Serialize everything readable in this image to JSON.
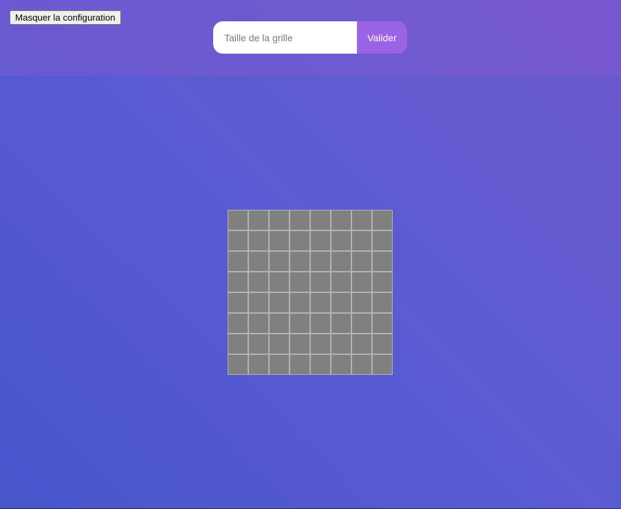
{
  "config": {
    "toggle_label": "Masquer la configuration",
    "grid_size_placeholder": "Taille de la grille",
    "grid_size_value": "",
    "submit_label": "Valider"
  },
  "grid": {
    "rows": 8,
    "columns": 8,
    "cell_state": "hidden"
  },
  "colors": {
    "background_start": "#4856cc",
    "background_end": "#6b58cc",
    "accent": "#9b63e6",
    "cell": "#808080",
    "cell_border": "#b4b4b4"
  }
}
